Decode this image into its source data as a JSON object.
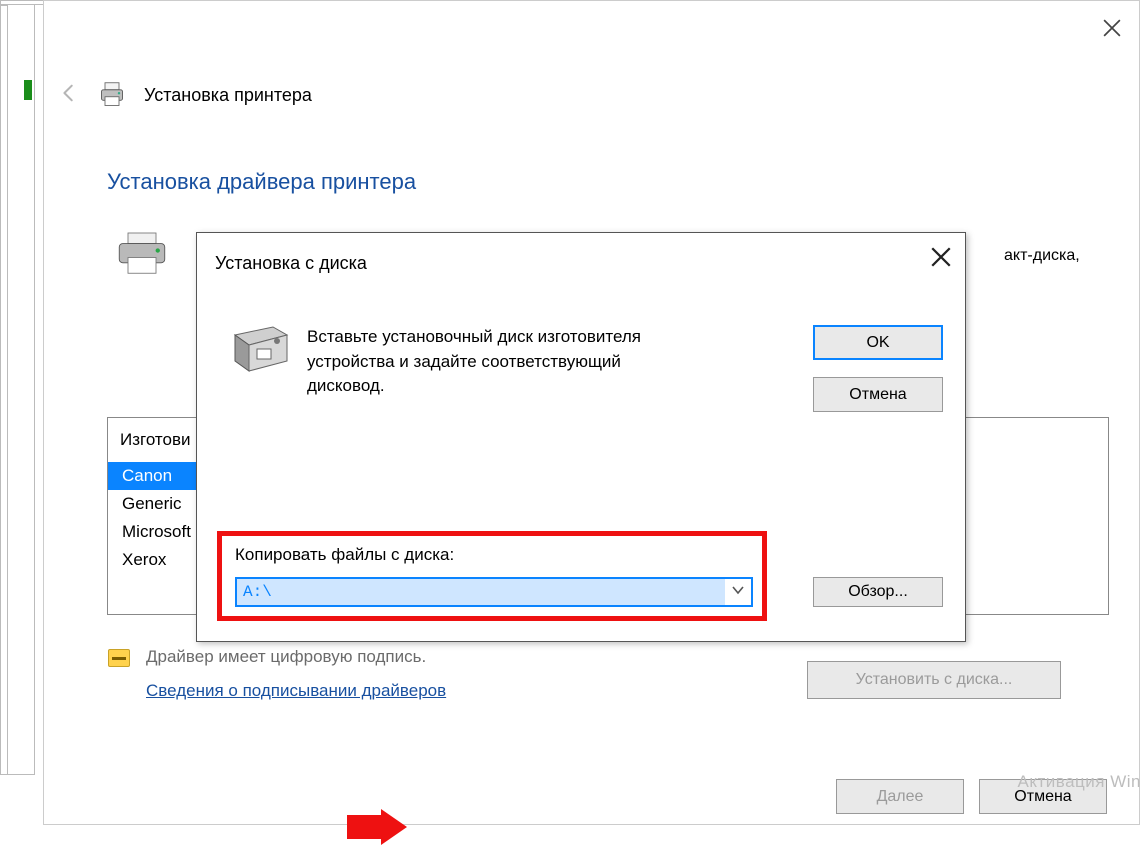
{
  "wizard": {
    "title": "Установка принтера",
    "heading": "Установка драйвера принтера",
    "cd_hint_tail": "акт-диска,",
    "mfg_header": "Изготови",
    "manufacturers": [
      "Canon",
      "Generic",
      "Microsoft",
      "Xerox"
    ],
    "selected_mfg_index": 0,
    "signature_text": "Драйвер имеет цифровую подпись.",
    "signature_link": "Сведения о подписывании драйверов",
    "install_from_disk_btn": "Установить с диска...",
    "next_btn": "Далее",
    "cancel_btn": "Отмена"
  },
  "dialog": {
    "title": "Установка с диска",
    "message": "Вставьте установочный диск изготовителя устройства и задайте соответствующий дисковод.",
    "ok_btn": "OK",
    "cancel_btn": "Отмена",
    "copy_label": "Копировать файлы с диска:",
    "path_value": "A:\\",
    "browse_btn": "Обзор..."
  },
  "watermark": "Активация Win"
}
